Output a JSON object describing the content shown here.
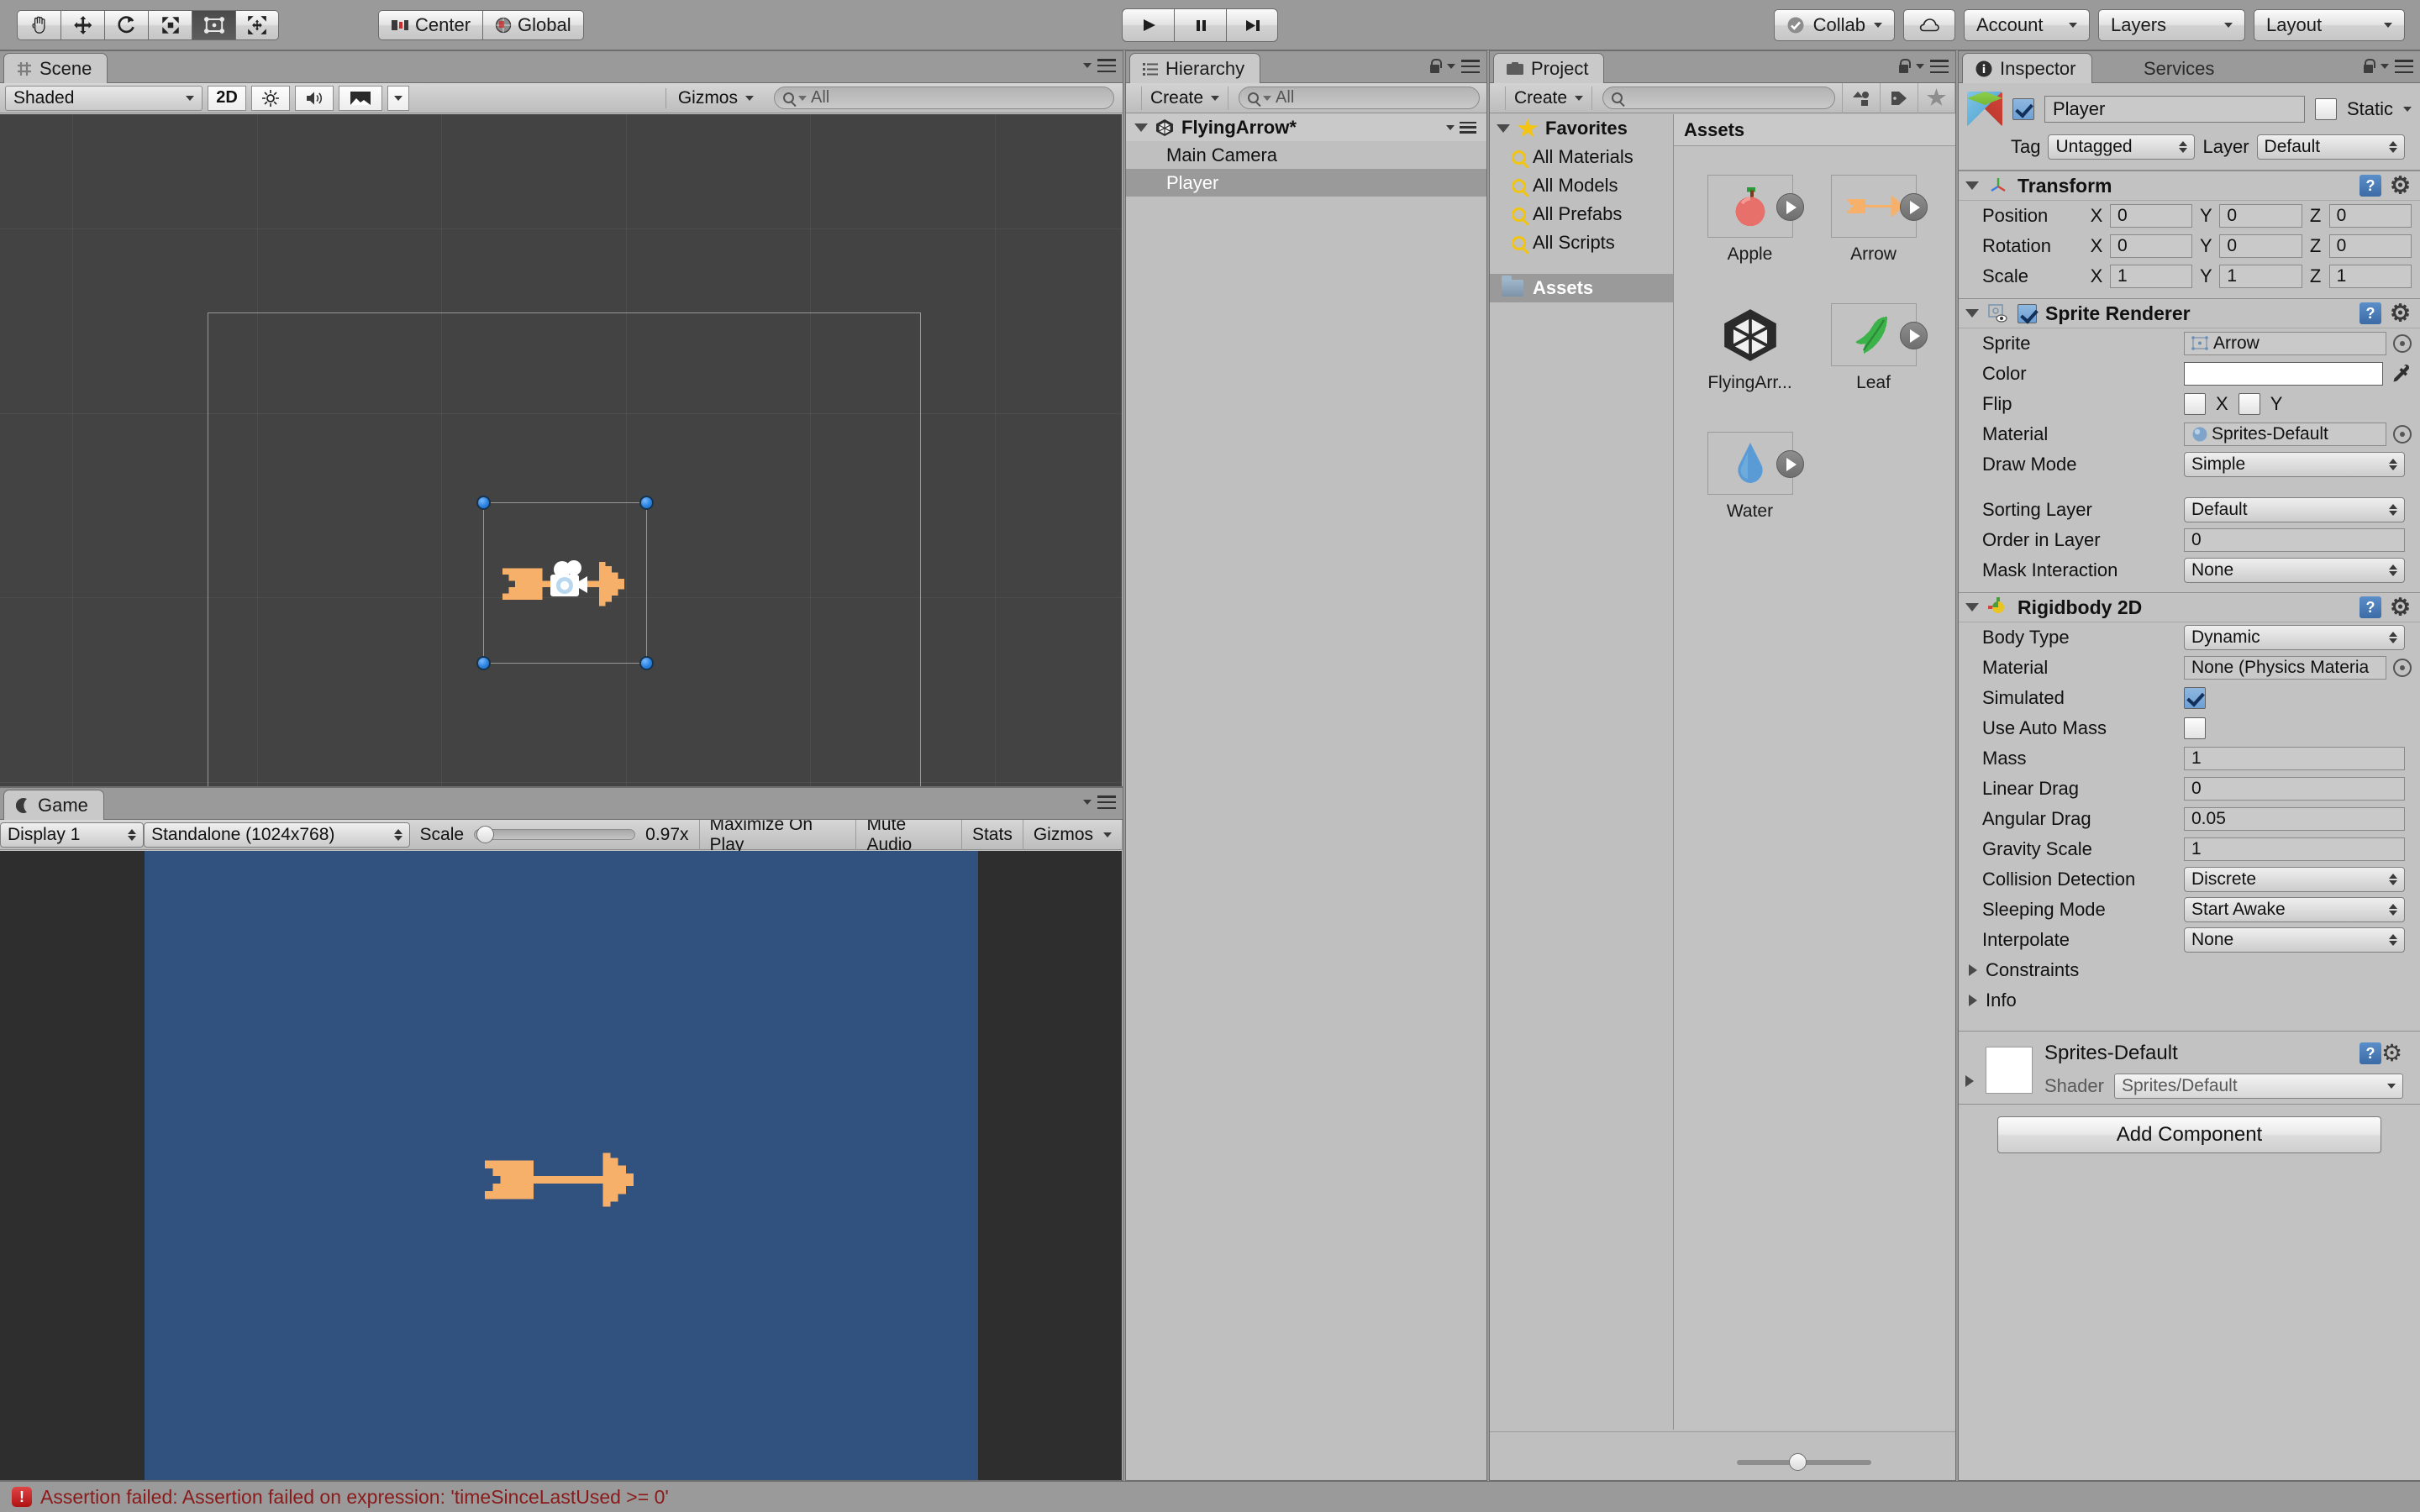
{
  "toolbar": {
    "transform_tools": [
      {
        "name": "hand-tool",
        "glyph": "✋",
        "active": false
      },
      {
        "name": "move-tool",
        "glyph": "✥",
        "active": false
      },
      {
        "name": "rotate-tool",
        "glyph": "↻",
        "active": false
      },
      {
        "name": "scale-tool",
        "glyph": "⤡",
        "active": false
      },
      {
        "name": "rect-tool",
        "glyph": "▣",
        "active": true
      },
      {
        "name": "transform-tool",
        "glyph": "✛",
        "active": false
      }
    ],
    "center_label": "Center",
    "global_label": "Global",
    "play_label": "▶",
    "pause_label": "❙❙",
    "step_label": "▶❙",
    "collab_label": "Collab",
    "cloud_label": "cloud-icon",
    "account_label": "Account",
    "layers_label": "Layers",
    "layout_label": "Layout"
  },
  "scene": {
    "tab_label": "Scene",
    "shading_mode": "Shaded",
    "mode_2d": "2D",
    "gizmos_label": "Gizmos",
    "search_placeholder": "All",
    "search_value": ""
  },
  "game": {
    "tab_label": "Game",
    "display": "Display 1",
    "resolution": "Standalone (1024x768)",
    "scale_label": "Scale",
    "scale_value": "0.97x",
    "maximize_label": "Maximize On Play",
    "mute_label": "Mute Audio",
    "stats_label": "Stats",
    "gizmos_label": "Gizmos",
    "background_color": "#31517e"
  },
  "hierarchy": {
    "tab_label": "Hierarchy",
    "create_label": "Create",
    "search_placeholder": "All",
    "search_value": "",
    "items": [
      {
        "label": "FlyingArrow*",
        "depth": 0,
        "selected": false,
        "root": true
      },
      {
        "label": "Main Camera",
        "depth": 1,
        "selected": false,
        "root": false
      },
      {
        "label": "Player",
        "depth": 1,
        "selected": true,
        "root": false
      }
    ]
  },
  "project": {
    "tab_label": "Project",
    "create_label": "Create",
    "search_placeholder": "",
    "search_value": "",
    "tree": [
      {
        "label": "Favorites",
        "type": "favorites",
        "selected": false
      },
      {
        "label": "All Materials",
        "type": "search",
        "selected": false
      },
      {
        "label": "All Models",
        "type": "search",
        "selected": false
      },
      {
        "label": "All Prefabs",
        "type": "search",
        "selected": false
      },
      {
        "label": "All Scripts",
        "type": "search",
        "selected": false
      },
      {
        "label": "Assets",
        "type": "folder",
        "selected": true
      }
    ],
    "assets_header": "Assets",
    "assets": [
      {
        "label": "Apple",
        "icon": "apple-sprite",
        "color": "#e8706a",
        "has_play": true
      },
      {
        "label": "Arrow",
        "icon": "arrow-sprite",
        "color": "#f7b26a",
        "has_play": true
      },
      {
        "label": "FlyingArr...",
        "icon": "unity-scene",
        "color": "#2b2b2b",
        "has_play": false
      },
      {
        "label": "Leaf",
        "icon": "leaf-sprite",
        "color": "#3cb34a",
        "has_play": true
      },
      {
        "label": "Water",
        "icon": "water-drop-sprite",
        "color": "#5b9bd5",
        "has_play": true
      }
    ]
  },
  "inspector": {
    "tab_label": "Inspector",
    "services_tab_label": "Services",
    "object_name": "Player",
    "object_enabled": true,
    "static_label": "Static",
    "static_checked": false,
    "tag_label": "Tag",
    "tag_value": "Untagged",
    "layer_label": "Layer",
    "layer_value": "Default",
    "transform": {
      "title": "Transform",
      "rows": [
        {
          "label": "Position",
          "x": "0",
          "y": "0",
          "z": "0"
        },
        {
          "label": "Rotation",
          "x": "0",
          "y": "0",
          "z": "0"
        },
        {
          "label": "Scale",
          "x": "1",
          "y": "1",
          "z": "1"
        }
      ],
      "axis_labels": [
        "X",
        "Y",
        "Z"
      ]
    },
    "sprite_renderer": {
      "title": "Sprite Renderer",
      "enabled": true,
      "sprite_label": "Sprite",
      "sprite_value": "Arrow",
      "color_label": "Color",
      "color_value": "#ffffff",
      "flip_label": "Flip",
      "flip_x_label": "X",
      "flip_x": false,
      "flip_y_label": "Y",
      "flip_y": false,
      "material_label": "Material",
      "material_value": "Sprites-Default",
      "draw_mode_label": "Draw Mode",
      "draw_mode_value": "Simple",
      "sorting_layer_label": "Sorting Layer",
      "sorting_layer_value": "Default",
      "order_label": "Order in Layer",
      "order_value": "0",
      "mask_label": "Mask Interaction",
      "mask_value": "None"
    },
    "rigidbody2d": {
      "title": "Rigidbody 2D",
      "rows": [
        {
          "label": "Body Type",
          "value": "Dynamic",
          "kind": "dropdown"
        },
        {
          "label": "Material",
          "value": "None (Physics Materia",
          "kind": "object"
        },
        {
          "label": "Simulated",
          "value": true,
          "kind": "checkbox"
        },
        {
          "label": "Use Auto Mass",
          "value": false,
          "kind": "checkbox"
        },
        {
          "label": "Mass",
          "value": "1",
          "kind": "field"
        },
        {
          "label": "Linear Drag",
          "value": "0",
          "kind": "field"
        },
        {
          "label": "Angular Drag",
          "value": "0.05",
          "kind": "field"
        },
        {
          "label": "Gravity Scale",
          "value": "1",
          "kind": "field"
        },
        {
          "label": "Collision Detection",
          "value": "Discrete",
          "kind": "dropdown"
        },
        {
          "label": "Sleeping Mode",
          "value": "Start Awake",
          "kind": "dropdown"
        },
        {
          "label": "Interpolate",
          "value": "None",
          "kind": "dropdown"
        }
      ],
      "constraints_label": "Constraints",
      "info_label": "Info"
    },
    "material_preview": {
      "title": "Sprites-Default",
      "shader_label": "Shader",
      "shader_value": "Sprites/Default"
    },
    "add_component_label": "Add Component"
  },
  "status": {
    "message": "Assertion failed: Assertion failed on expression: 'timeSinceLastUsed >= 0'",
    "icon": "error-icon",
    "color": "#8b1a1a"
  }
}
